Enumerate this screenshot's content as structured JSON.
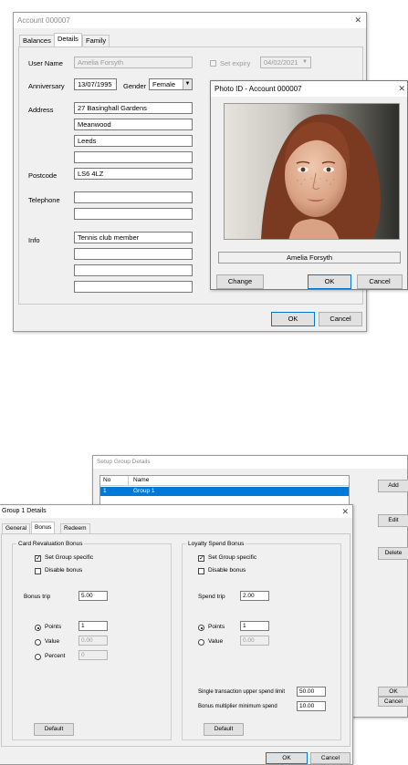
{
  "account": {
    "title": "Account 000007",
    "tabs": [
      "Balances",
      "Details",
      "Family"
    ],
    "user_name_label": "User Name",
    "user_name": "Amelia Forsyth",
    "set_expiry_label": "Set expiry",
    "expiry_date": "04/02/2021",
    "anniversary_label": "Anniversary",
    "anniversary": "13/07/1995",
    "gender_label": "Gender",
    "gender": "Female",
    "address_label": "Address",
    "address": [
      "27 Basinghall Gardens",
      "Meanwood",
      "Leeds",
      ""
    ],
    "postcode_label": "Postcode",
    "postcode": "LS6 4LZ",
    "telephone_label": "Telephone",
    "telephone": [
      "",
      ""
    ],
    "info_label": "Info",
    "info": [
      "Tennis club member",
      "",
      "",
      ""
    ],
    "ok": "OK",
    "cancel": "Cancel"
  },
  "photo": {
    "title": "Photo ID - Account 000007",
    "name": "Amelia Forsyth",
    "change": "Change",
    "ok": "OK",
    "cancel": "Cancel"
  },
  "setup": {
    "title": "Setup Group Details",
    "col_no": "No",
    "col_name": "Name",
    "row_no": "1",
    "row_name": "Group 1",
    "add": "Add",
    "edit": "Edit",
    "delete": "Delete",
    "ok": "OK",
    "cancel": "Cancel"
  },
  "group": {
    "title": "Group 1 Details",
    "tabs": [
      "General",
      "Bonus",
      "Redeem"
    ],
    "card": {
      "title": "Card Revaluation Bonus",
      "set_group": "Set Group specific",
      "disable": "Disable bonus",
      "bonus_trip_label": "Bonus trip",
      "bonus_trip": "5.00",
      "points_label": "Points",
      "points": "1",
      "value_label": "Value",
      "value": "0.00",
      "percent_label": "Percent",
      "percent": "0",
      "default": "Default"
    },
    "loyalty": {
      "title": "Loyalty Spend Bonus",
      "set_group": "Set Group specific",
      "disable": "Disable bonus",
      "spend_trip_label": "Spend trip",
      "spend_trip": "2.00",
      "points_label": "Points",
      "points": "1",
      "value_label": "Value",
      "value": "0.00",
      "single_limit_label": "Single transaction upper spend limit",
      "single_limit": "50.00",
      "multiplier_label": "Bonus multiplier minimum spend",
      "multiplier": "10.00",
      "default": "Default"
    },
    "ok": "OK",
    "cancel": "Cancel"
  },
  "colors": {
    "accent": "#0078d7",
    "selection": "#0078d7"
  },
  "icons": [
    "close-icon",
    "dropdown-arrow-icon",
    "checkbox-icon",
    "radio-icon"
  ]
}
